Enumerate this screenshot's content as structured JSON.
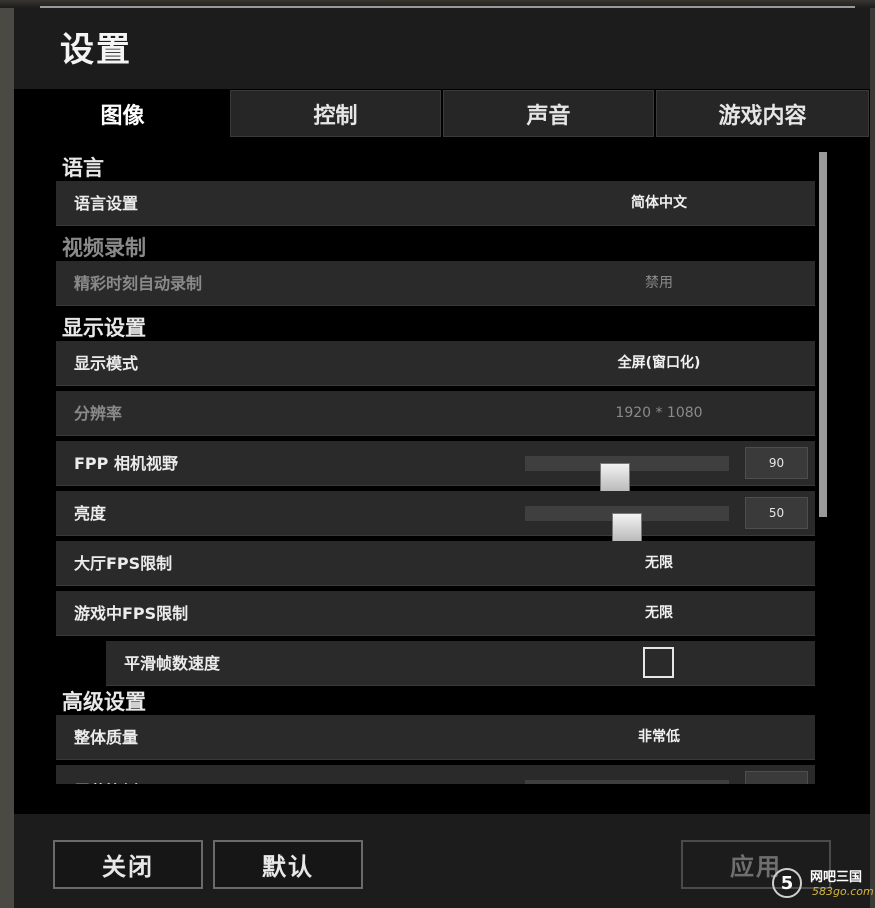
{
  "header": {
    "title": "设置"
  },
  "tabs": [
    {
      "label": "图像",
      "active": true
    },
    {
      "label": "控制",
      "active": false
    },
    {
      "label": "声音",
      "active": false
    },
    {
      "label": "游戏内容",
      "active": false
    }
  ],
  "sections": {
    "language": {
      "title": "语言",
      "language_setting": {
        "label": "语言设置",
        "value": "简体中文"
      }
    },
    "video_recording": {
      "title": "视频录制",
      "auto_record": {
        "label": "精彩时刻自动录制",
        "value": "禁用",
        "disabled": true
      }
    },
    "display": {
      "title": "显示设置",
      "display_mode": {
        "label": "显示模式",
        "value": "全屏(窗口化)"
      },
      "resolution": {
        "label": "分辨率",
        "value": "1920 * 1080",
        "disabled": true
      },
      "fpp_fov": {
        "label": "FPP 相机视野",
        "value": "90",
        "level": 0.43
      },
      "brightness": {
        "label": "亮度",
        "value": "50",
        "level": 0.5
      },
      "lobby_fps": {
        "label": "大厅FPS限制",
        "value": "无限"
      },
      "ingame_fps": {
        "label": "游戏中FPS限制",
        "value": "无限"
      },
      "smooth_frame": {
        "label": "平滑帧数速度",
        "checked": false
      }
    },
    "advanced": {
      "title": "高级设置",
      "overall_quality": {
        "label": "整体质量",
        "value": "非常低"
      },
      "screen_scale": {
        "label": "屏幕比例"
      }
    }
  },
  "footer": {
    "close_label": "关闭",
    "default_label": "默认",
    "apply_label": "应用"
  },
  "watermark": {
    "logo_char": "5",
    "text": "网吧三国",
    "sub": "583go.com"
  },
  "colors": {
    "background": "#1c1c1c",
    "row": "#2a2a2a",
    "panel": "#000000",
    "text": "#e8e8e8",
    "disabled_text": "#8a8a8a"
  }
}
